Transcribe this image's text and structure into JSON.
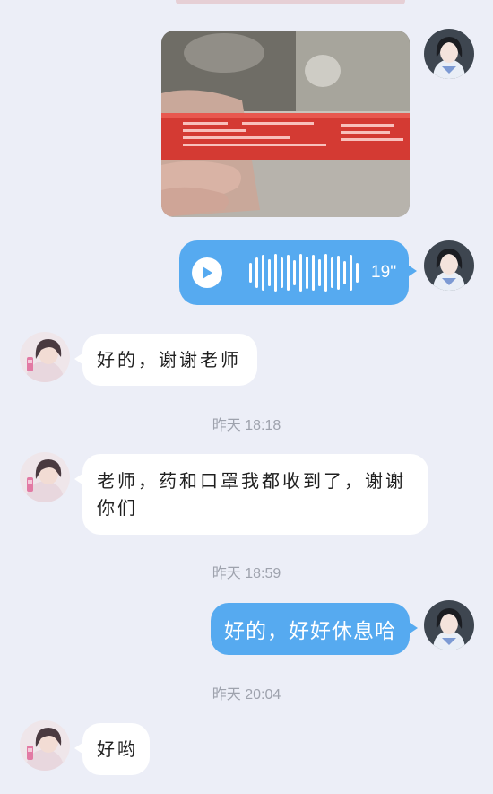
{
  "chat": {
    "messages": [
      {
        "type": "image",
        "sender": "me"
      },
      {
        "type": "voice",
        "sender": "me",
        "duration": "19''"
      },
      {
        "type": "text",
        "sender": "contact",
        "text": "好的，谢谢老师"
      },
      {
        "type": "timestamp",
        "text": "昨天 18:18"
      },
      {
        "type": "text",
        "sender": "contact",
        "text_line1": "老师，药和口罩我都收到了，谢谢",
        "text_line2": "你们"
      },
      {
        "type": "timestamp",
        "text": "昨天 18:59"
      },
      {
        "type": "text",
        "sender": "me",
        "text": "好的，好好休息哈"
      },
      {
        "type": "timestamp",
        "text": "昨天 20:04"
      },
      {
        "type": "text",
        "sender": "contact",
        "text": "好哟"
      }
    ]
  },
  "colors": {
    "background": "#eceef7",
    "outgoing_bubble": "#56aaf0",
    "incoming_bubble": "#ffffff",
    "timestamp_text": "#9ea2ad"
  },
  "icons": {
    "voice_play": "play-icon",
    "voice_wave": "waveform-icon"
  }
}
